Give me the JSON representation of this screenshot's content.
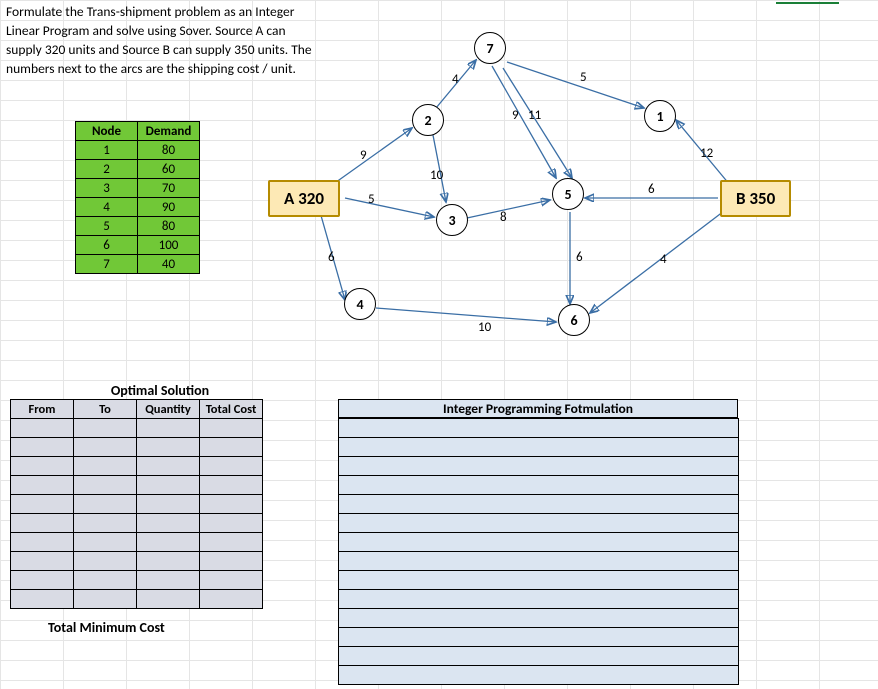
{
  "problem_text": "Formulate the Trans-shipment problem as an Integer Linear Program and solve using Sover.  Source A can supply 320 units and Source B can supply 350 units.  The numbers next to the arcs are the shipping cost / unit.",
  "demand": {
    "headers": [
      "Node",
      "Demand"
    ],
    "rows": [
      [
        "1",
        "80"
      ],
      [
        "2",
        "60"
      ],
      [
        "3",
        "70"
      ],
      [
        "4",
        "90"
      ],
      [
        "5",
        "80"
      ],
      [
        "6",
        "100"
      ],
      [
        "7",
        "40"
      ]
    ]
  },
  "sources": {
    "A": {
      "label": "A  320"
    },
    "B": {
      "label": "B  350"
    }
  },
  "nodes": {
    "n1": "1",
    "n2": "2",
    "n3": "3",
    "n4": "4",
    "n5": "5",
    "n6": "6",
    "n7": "7"
  },
  "arc_costs": {
    "A_2": "9",
    "A_3": "5",
    "A_4": "6",
    "2_7": "4",
    "2_3": "10",
    "3_5": "8",
    "7_5_a": "9",
    "7_5_b": "11",
    "7_1": "5",
    "4_6": "10",
    "5_6": "6",
    "B_1": "12",
    "B_6": "4",
    "B_5": "6"
  },
  "optimal": {
    "title": "Optimal Solution",
    "headers": [
      "From",
      "To",
      "Quantity",
      "Total Cost"
    ],
    "total_label": "Total Minimum Cost"
  },
  "ip": {
    "title": "Integer Programming Fotmulation"
  }
}
